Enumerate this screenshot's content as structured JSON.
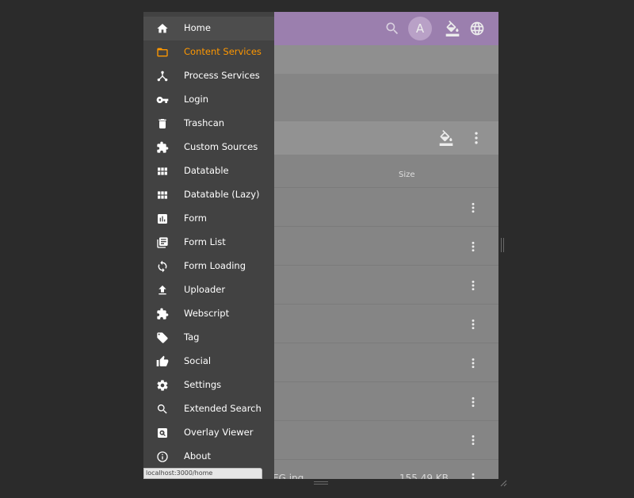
{
  "header": {
    "avatar_initial": "A",
    "icons": [
      "search-icon",
      "paint-bucket-icon",
      "globe-icon"
    ]
  },
  "table": {
    "size_header": "Size",
    "visible_row": {
      "name_fragment": "EG.jpg",
      "size": "155.49 KB"
    }
  },
  "sidebar": {
    "items": [
      {
        "label": "Home",
        "icon": "home-icon"
      },
      {
        "label": "Content Services",
        "icon": "folder-icon"
      },
      {
        "label": "Process Services",
        "icon": "process-icon"
      },
      {
        "label": "Login",
        "icon": "key-icon"
      },
      {
        "label": "Trashcan",
        "icon": "trash-icon"
      },
      {
        "label": "Custom Sources",
        "icon": "puzzle-icon"
      },
      {
        "label": "Datatable",
        "icon": "grid-icon"
      },
      {
        "label": "Datatable (Lazy)",
        "icon": "grid-icon"
      },
      {
        "label": "Form",
        "icon": "bar-chart-icon"
      },
      {
        "label": "Form List",
        "icon": "library-books-icon"
      },
      {
        "label": "Form Loading",
        "icon": "sync-icon"
      },
      {
        "label": "Uploader",
        "icon": "upload-icon"
      },
      {
        "label": "Webscript",
        "icon": "puzzle-icon"
      },
      {
        "label": "Tag",
        "icon": "tag-icon"
      },
      {
        "label": "Social",
        "icon": "thumb-up-icon"
      },
      {
        "label": "Settings",
        "icon": "gear-icon"
      },
      {
        "label": "Extended Search",
        "icon": "search-icon"
      },
      {
        "label": "Overlay Viewer",
        "icon": "image-search-icon"
      },
      {
        "label": "About",
        "icon": "info-icon"
      }
    ],
    "active_label": "Content Services",
    "accent_color": "#ff9800"
  },
  "status_bar": {
    "url": "localhost:3000/home"
  }
}
